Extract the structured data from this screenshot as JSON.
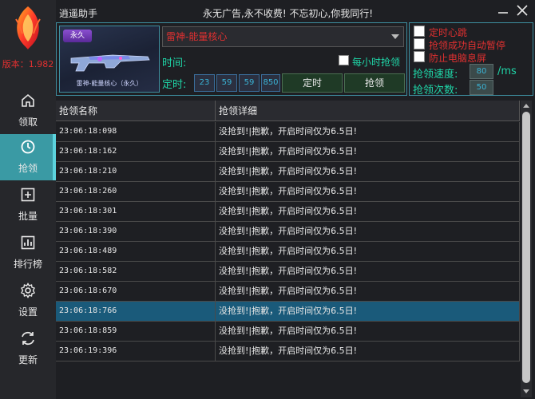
{
  "app": {
    "title": "逍遥助手",
    "slogan": "永无广告,永不收费!   不忘初心,你我同行!",
    "version": "版本：1.982"
  },
  "sidebar": {
    "items": [
      {
        "label": "领取",
        "icon": "home-icon"
      },
      {
        "label": "抢领",
        "icon": "clock-icon",
        "active": true
      },
      {
        "label": "批量",
        "icon": "plus-square-icon"
      },
      {
        "label": "排行榜",
        "icon": "chart-icon"
      },
      {
        "label": "设置",
        "icon": "gear-icon"
      },
      {
        "label": "更新",
        "icon": "refresh-icon"
      }
    ]
  },
  "item": {
    "tag": "永久",
    "caption": "雷神-能量核心（永久）",
    "selected": "雷神-能量核心"
  },
  "controls": {
    "time_label": "时间:",
    "hourly_label": "每小时抢领",
    "timer_label": "定时:",
    "time_values": [
      "23",
      "59",
      "59",
      "850"
    ],
    "timer_button": "定时",
    "grab_button": "抢领"
  },
  "options": {
    "heartbeat": "定时心跳",
    "auto_pause": "抢领成功自动暂停",
    "prevent_sleep": "防止电脑息屏",
    "speed_label": "抢领速度:",
    "speed_value": "80",
    "speed_unit": "/ms",
    "count_label": "抢领次数:",
    "count_value": "50"
  },
  "table": {
    "columns": [
      "抢领名称",
      "抢领详细"
    ],
    "rows": [
      {
        "time": "23:06:18:098",
        "detail": "没抢到!|抱歉，开启时间仅为6.5日!"
      },
      {
        "time": "23:06:18:162",
        "detail": "没抢到!|抱歉，开启时间仅为6.5日!"
      },
      {
        "time": "23:06:18:210",
        "detail": "没抢到!|抱歉，开启时间仅为6.5日!"
      },
      {
        "time": "23:06:18:260",
        "detail": "没抢到!|抱歉，开启时间仅为6.5日!"
      },
      {
        "time": "23:06:18:301",
        "detail": "没抢到!|抱歉，开启时间仅为6.5日!"
      },
      {
        "time": "23:06:18:390",
        "detail": "没抢到!|抱歉，开启时间仅为6.5日!"
      },
      {
        "time": "23:06:18:489",
        "detail": "没抢到!|抱歉，开启时间仅为6.5日!"
      },
      {
        "time": "23:06:18:582",
        "detail": "没抢到!|抱歉，开启时间仅为6.5日!"
      },
      {
        "time": "23:06:18:670",
        "detail": "没抢到!|抱歉，开启时间仅为6.5日!"
      },
      {
        "time": "23:06:18:766",
        "detail": "没抢到!|抱歉，开启时间仅为6.5日!",
        "selected": true
      },
      {
        "time": "23:06:18:859",
        "detail": "没抢到!|抱歉，开启时间仅为6.5日!"
      },
      {
        "time": "23:06:19:396",
        "detail": "没抢到!|抱歉，开启时间仅为6.5日!"
      }
    ]
  },
  "colors": {
    "accent": "#3a9aa4",
    "green_text": "#1fd6a8",
    "red_text": "#e03030",
    "selected_row": "#1a5a7a"
  }
}
